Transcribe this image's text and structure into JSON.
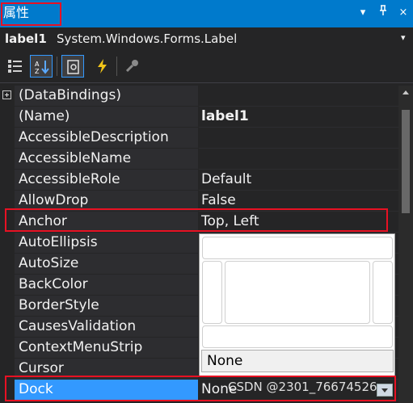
{
  "window": {
    "title": "属性",
    "dropdown_glyph": "▾",
    "pin_glyph": "⊥",
    "close_glyph": "×"
  },
  "object_selector": {
    "name": "label1",
    "type": "System.Windows.Forms.Label",
    "arrow": "▾"
  },
  "toolbar": {
    "icons": [
      "categorized-icon",
      "alphabetical-icon",
      "properties-icon",
      "events-icon",
      "property-pages-icon"
    ]
  },
  "properties": [
    {
      "name": "(DataBindings)",
      "value": ""
    },
    {
      "name": "(Name)",
      "value": "label1"
    },
    {
      "name": "AccessibleDescription",
      "value": ""
    },
    {
      "name": "AccessibleName",
      "value": ""
    },
    {
      "name": "AccessibleRole",
      "value": "Default"
    },
    {
      "name": "AllowDrop",
      "value": "False"
    },
    {
      "name": "Anchor",
      "value": "Top, Left"
    },
    {
      "name": "AutoEllipsis",
      "value": ""
    },
    {
      "name": "AutoSize",
      "value": ""
    },
    {
      "name": "BackColor",
      "value": ""
    },
    {
      "name": "BorderStyle",
      "value": ""
    },
    {
      "name": "CausesValidation",
      "value": ""
    },
    {
      "name": "ContextMenuStrip",
      "value": ""
    },
    {
      "name": "Cursor",
      "value": ""
    },
    {
      "name": "Dock",
      "value": "None"
    }
  ],
  "anchor_editor": {
    "none_label": "None"
  },
  "watermark": "CSDN @2301_76674526",
  "colors": {
    "accent": "#007acc",
    "selection": "#3399ff",
    "highlight_red": "#e81123",
    "background": "#252526"
  }
}
